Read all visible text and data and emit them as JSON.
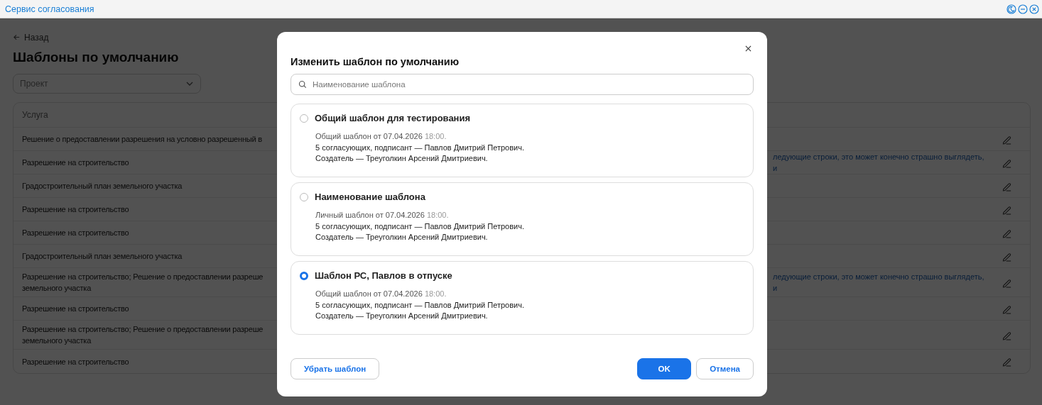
{
  "window": {
    "title": "Сервис согласования"
  },
  "page": {
    "back": "Назад",
    "title": "Шаблоны по умолчанию",
    "filter": {
      "placeholder": "Проект"
    }
  },
  "table": {
    "columns": [
      "Услуга"
    ],
    "rows": [
      {
        "service": [
          "Решение о предоставлении разрешения на условно разрешенный в"
        ],
        "column_2": []
      },
      {
        "service": [
          "Разрешение на строительство"
        ],
        "column_2": [
          "ледующие строки, это может конечно страшно выглядеть,",
          "и"
        ]
      },
      {
        "service": [
          "Градостроительный план земельного участка"
        ],
        "column_2": []
      },
      {
        "service": [
          "Разрешение на строительство"
        ],
        "column_2": []
      },
      {
        "service": [
          "Разрешение на строительство"
        ],
        "column_2": []
      },
      {
        "service": [
          "Градостроительный план земельного участка"
        ],
        "column_2": []
      },
      {
        "service": [
          "Разрешение на строительство; Решение о предоставлении разреше",
          "земельного участка"
        ],
        "column_2": [
          "ледующие строки, это может конечно страшно выглядеть,",
          "и"
        ]
      },
      {
        "service": [
          "Разрешение на строительство"
        ],
        "column_2": []
      },
      {
        "service": [
          "Разрешение на строительство; Решение о предоставлении разреше",
          "земельного участка"
        ],
        "column_2": []
      },
      {
        "service": [
          "Разрешение на строительство"
        ],
        "column_2": []
      }
    ]
  },
  "dialog": {
    "title": "Изменить шаблон по умолчанию",
    "search": {
      "placeholder": "Наименование шаблона"
    },
    "templates": [
      {
        "name": "Общий шаблон для тестирования",
        "selected": false,
        "origin": "Общий шаблон от 07.04.2026",
        "time": "18:00.",
        "approvers": "5 согласующих, подписант — Павлов Дмитрий Петрович.",
        "creator": "Создатель — Треуголкин Арсений Дмитриевич."
      },
      {
        "name": "Наименование шаблона",
        "selected": false,
        "origin": "Личный шаблон от 07.04.2026",
        "time": "18:00.",
        "approvers": "5 согласующих, подписант — Павлов Дмитрий Петрович.",
        "creator": "Создатель — Треуголкин Арсений Дмитриевич."
      },
      {
        "name": "Шаблон РС, Павлов в отпуске",
        "selected": true,
        "origin": "Общий шаблон от 07.04.2026",
        "time": "18:00.",
        "approvers": "5 согласующих, подписант — Павлов Дмитрий Петрович.",
        "creator": "Создатель — Треуголкин Арсений Дмитриевич."
      }
    ],
    "buttons": {
      "remove": "Убрать шаблон",
      "ok": "OK",
      "cancel": "Отмена"
    }
  }
}
